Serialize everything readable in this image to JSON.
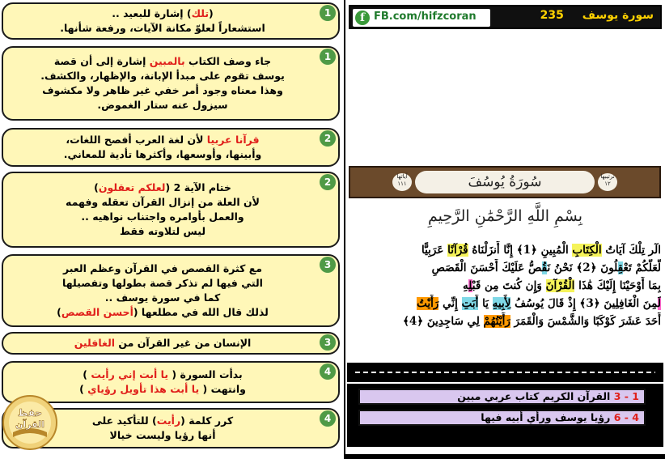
{
  "header": {
    "fb_handle": "FB.com/hifzcoran",
    "surah_title": "سورة يوسف",
    "page_number": "235"
  },
  "notes": [
    {
      "num": "1",
      "lines": [
        [
          {
            "t": "(",
            "c": ""
          },
          {
            "t": "تلك",
            "c": "red"
          },
          {
            "t": ") إشارة للبعيد ..",
            "c": ""
          }
        ],
        [
          {
            "t": "استشعاراً لعلوّ مكانة الآيات، ورفعة شأنها.",
            "c": ""
          }
        ]
      ]
    },
    {
      "num": "1",
      "lines": [
        [
          {
            "t": "جاء وصف الكتاب ",
            "c": ""
          },
          {
            "t": "بالمبين",
            "c": "red"
          },
          {
            "t": " إشارة إلى أن قصة",
            "c": ""
          }
        ],
        [
          {
            "t": "يوسف تقوم على مبدأ الإبانة، والإظهار، والكشف.",
            "c": ""
          }
        ],
        [
          {
            "t": "وهذا معناه وجود أمر خفي غير ظاهر ولا مكشوف",
            "c": ""
          }
        ],
        [
          {
            "t": "سيزول عنه ستار الغموض.",
            "c": ""
          }
        ]
      ]
    },
    {
      "num": "2",
      "lines": [
        [
          {
            "t": "قرآنا عربيا",
            "c": "red"
          },
          {
            "t": " لأن لغة العرب أفصح اللغات،",
            "c": ""
          }
        ],
        [
          {
            "t": "وأبينها، وأوسعها، وأكثرها تأدية للمعاني.",
            "c": ""
          }
        ]
      ]
    },
    {
      "num": "2",
      "lines": [
        [
          {
            "t": "ختام الآية 2 (",
            "c": ""
          },
          {
            "t": "لعلكم تعقلون",
            "c": "red"
          },
          {
            "t": ")",
            "c": ""
          }
        ],
        [
          {
            "t": "لأن العلة من إنزال القرآن تعقله وفهمه",
            "c": ""
          }
        ],
        [
          {
            "t": "والعمل بأوامره واجتناب نواهيه ..",
            "c": ""
          }
        ],
        [
          {
            "t": "ليس لتلاوته فقط",
            "c": ""
          }
        ]
      ]
    },
    {
      "num": "3",
      "lines": [
        [
          {
            "t": "مع كثرة القصص في القرآن وعظم العبر",
            "c": ""
          }
        ],
        [
          {
            "t": "التي فيها لم تذكر قصة بطولها وتفصيلها",
            "c": ""
          }
        ],
        [
          {
            "t": "كما في سورة يوسف ..",
            "c": ""
          }
        ],
        [
          {
            "t": "لذلك قال الله في مطلعها (",
            "c": ""
          },
          {
            "t": "أحسن القصص",
            "c": "red"
          },
          {
            "t": ")",
            "c": ""
          }
        ]
      ]
    },
    {
      "num": "3",
      "lines": [
        [
          {
            "t": "الإنسان من غير القرآن من ",
            "c": ""
          },
          {
            "t": "الغافلين",
            "c": "red"
          }
        ]
      ]
    },
    {
      "num": "4",
      "lines": [
        [
          {
            "t": "بدأت السورة ( ",
            "c": ""
          },
          {
            "t": "يا أبت إني رأيت",
            "c": "red"
          },
          {
            "t": " )",
            "c": ""
          }
        ],
        [
          {
            "t": "وانتهت ( ",
            "c": ""
          },
          {
            "t": "يا أبت هذا تأويل رؤياي",
            "c": "red"
          },
          {
            "t": " )",
            "c": ""
          }
        ]
      ]
    },
    {
      "num": "4",
      "lines": [
        [
          {
            "t": "كرر كلمة (",
            "c": ""
          },
          {
            "t": "رأيت",
            "c": "red"
          },
          {
            "t": ") للتأكيد على",
            "c": ""
          }
        ],
        [
          {
            "t": "أنها رؤيا وليست خيالا",
            "c": ""
          }
        ]
      ]
    }
  ],
  "banner": {
    "surah_name": "سُورَةُ يُوسُفَ",
    "left_info": "آياتها ١١١",
    "right_info": "ترتيبها ١٢"
  },
  "basmala": "بِسْمِ اللَّهِ الرَّحْمَٰنِ الرَّحِيمِ",
  "verse_lines": [
    [
      {
        "t": "الٓر تِلْكَ آيَاتُ ",
        "h": ""
      },
      {
        "t": "الْكِتَابِ",
        "h": "y"
      },
      {
        "t": " الْمُبِينِ ﴿1﴾ إِنَّا أَنزَلْنَاهُ ",
        "h": ""
      },
      {
        "t": "قُرْآنًا",
        "h": "y"
      },
      {
        "t": " عَرَبِيًّا",
        "h": ""
      }
    ],
    [
      {
        "t": "لَّعَلَّكُمْ تَعْ",
        "h": ""
      },
      {
        "t": "قِ",
        "h": "c"
      },
      {
        "t": "لُونَ ﴿2﴾ نَحْنُ نَ",
        "h": ""
      },
      {
        "t": "قُ",
        "h": "c"
      },
      {
        "t": "صُّ عَلَيْكَ أَحْسَنَ الْقَصَصِ",
        "h": ""
      }
    ],
    [
      {
        "t": "بِمَا أَوْحَيْنَا إِلَيْكَ هَٰذَا ",
        "h": ""
      },
      {
        "t": "الْقُرْآنَ",
        "h": "y"
      },
      {
        "t": " وَإِن كُنتَ مِن قَبْ",
        "h": ""
      },
      {
        "t": "لِ",
        "h": "p"
      },
      {
        "t": "هِ",
        "h": ""
      }
    ],
    [
      {
        "t": "لَ",
        "h": "p"
      },
      {
        "t": "مِنَ الْغَافِلِينَ ﴿3﴾ إِذْ قَالَ يُوسُفُ ",
        "h": ""
      },
      {
        "t": "لِأَبِيهِ",
        "h": "c"
      },
      {
        "t": " يَا ",
        "h": ""
      },
      {
        "t": "أَبَتِ",
        "h": "c"
      },
      {
        "t": " إِنِّي ",
        "h": ""
      },
      {
        "t": "رَأَيْتُ",
        "h": "o"
      }
    ],
    [
      {
        "t": "أَحَدَ عَشَرَ كَوْكَبًا وَالشَّمْسَ وَالْقَمَرَ ",
        "h": ""
      },
      {
        "t": "رَأَيْتُهُمْ",
        "h": "o"
      },
      {
        "t": " لِي سَاجِدِينَ ﴿4﴾",
        "h": ""
      }
    ]
  ],
  "summaries": [
    {
      "ref": "1 - 3",
      "text": "القرآن الكريم كتاب عربي مبين"
    },
    {
      "ref": "4 - 6",
      "text": "رؤيا يوسف ورأي أبيه فيها"
    }
  ],
  "logo": {
    "line1": "حفظ",
    "line2": "القرآن"
  },
  "colors": {
    "note_bg": "#fff7b8",
    "number_green": "#4f9a46",
    "highlight_red": "#e0201b",
    "title_yellow": "#ffd200",
    "summary_bg": "#d9c7ef"
  }
}
